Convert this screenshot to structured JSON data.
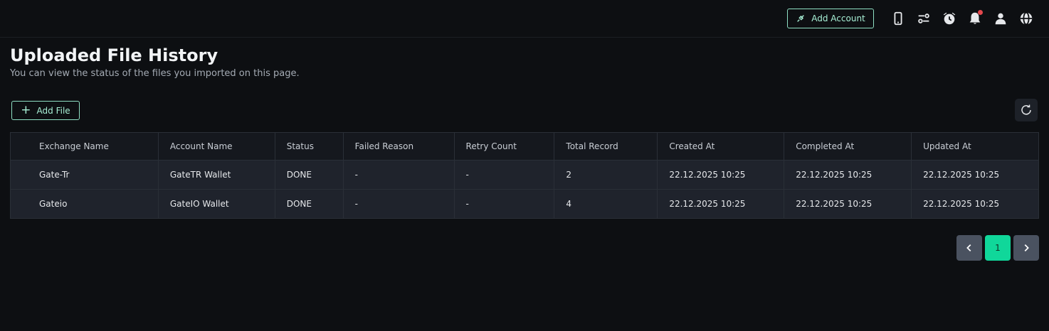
{
  "header": {
    "add_account_label": "Add Account",
    "icons": [
      "mobile-icon",
      "settings-sliders-icon",
      "alarm-clock-icon",
      "bell-icon",
      "user-icon",
      "globe-icon"
    ],
    "notification_dot_color": "#e5484d"
  },
  "page": {
    "title": "Uploaded File History",
    "subtitle": "You can view the status of the files you imported on this page."
  },
  "toolbar": {
    "add_file_label": "Add File",
    "refresh_icon": "refresh-icon"
  },
  "table": {
    "columns": [
      "Exchange Name",
      "Account Name",
      "Status",
      "Failed Reason",
      "Retry Count",
      "Total Record",
      "Created At",
      "Completed At",
      "Updated At"
    ],
    "rows": [
      [
        "Gate-Tr",
        "GateTR Wallet",
        "DONE",
        "-",
        "-",
        "2",
        "22.12.2025 10:25",
        "22.12.2025 10:25",
        "22.12.2025 10:25"
      ],
      [
        "Gateio",
        "GateIO Wallet",
        "DONE",
        "-",
        "-",
        "4",
        "22.12.2025 10:25",
        "22.12.2025 10:25",
        "22.12.2025 10:25"
      ]
    ]
  },
  "pagination": {
    "current_page": "1",
    "prev_icon": "chevron-left-icon",
    "next_icon": "chevron-right-icon"
  },
  "colors": {
    "accent": "#10d79a",
    "status_done": "#2ec08a",
    "background": "#0d0f12"
  }
}
